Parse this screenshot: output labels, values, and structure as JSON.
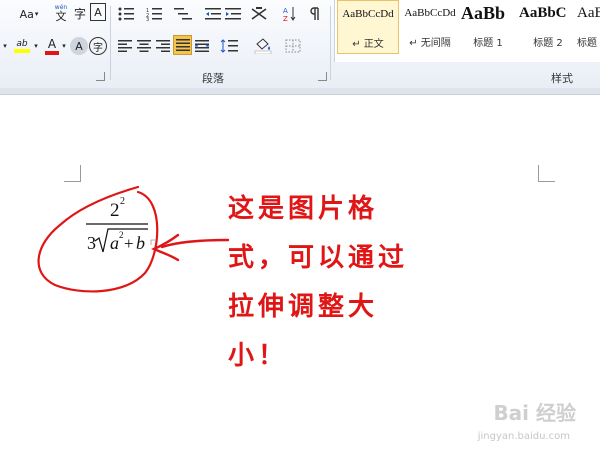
{
  "ribbon": {
    "font_group": {
      "change_case": "Aa",
      "phonetic": "文",
      "phonetic_top": "wén",
      "enclose": "字",
      "char_border": "A",
      "font_color": "A",
      "highlight_text": "ab",
      "enclose_char": "字"
    },
    "paragraph_group": {
      "label": "段落"
    },
    "styles_group": {
      "label": "样式",
      "items": [
        {
          "sample": "AaBbCcDd",
          "name": "正文",
          "active": true
        },
        {
          "sample": "AaBbCcDd",
          "name": "无间隔",
          "active": false
        },
        {
          "sample": "AaBb",
          "name": "标题 1",
          "active": false
        },
        {
          "sample": "AaBbC",
          "name": "标题 2",
          "active": false
        },
        {
          "sample": "AaB",
          "name": "标题",
          "active": false
        }
      ]
    },
    "colors": {
      "accent": "#f5c24a",
      "ribbon_border": "#c6cfdc"
    }
  },
  "document": {
    "formula": {
      "numerator_base": "2",
      "numerator_exp": "2",
      "denominator_coef": "3",
      "radicand_a": "a",
      "radicand_a_exp": "2",
      "plus": "+",
      "radicand_b": "b"
    },
    "annotation": {
      "lines": [
        "这是图片格",
        "式，可以通过",
        "拉伸调整大",
        "小！"
      ],
      "color": "#e01616"
    }
  },
  "watermark": {
    "main": "Bai 经验",
    "sub": "jingyan.baidu.com"
  }
}
